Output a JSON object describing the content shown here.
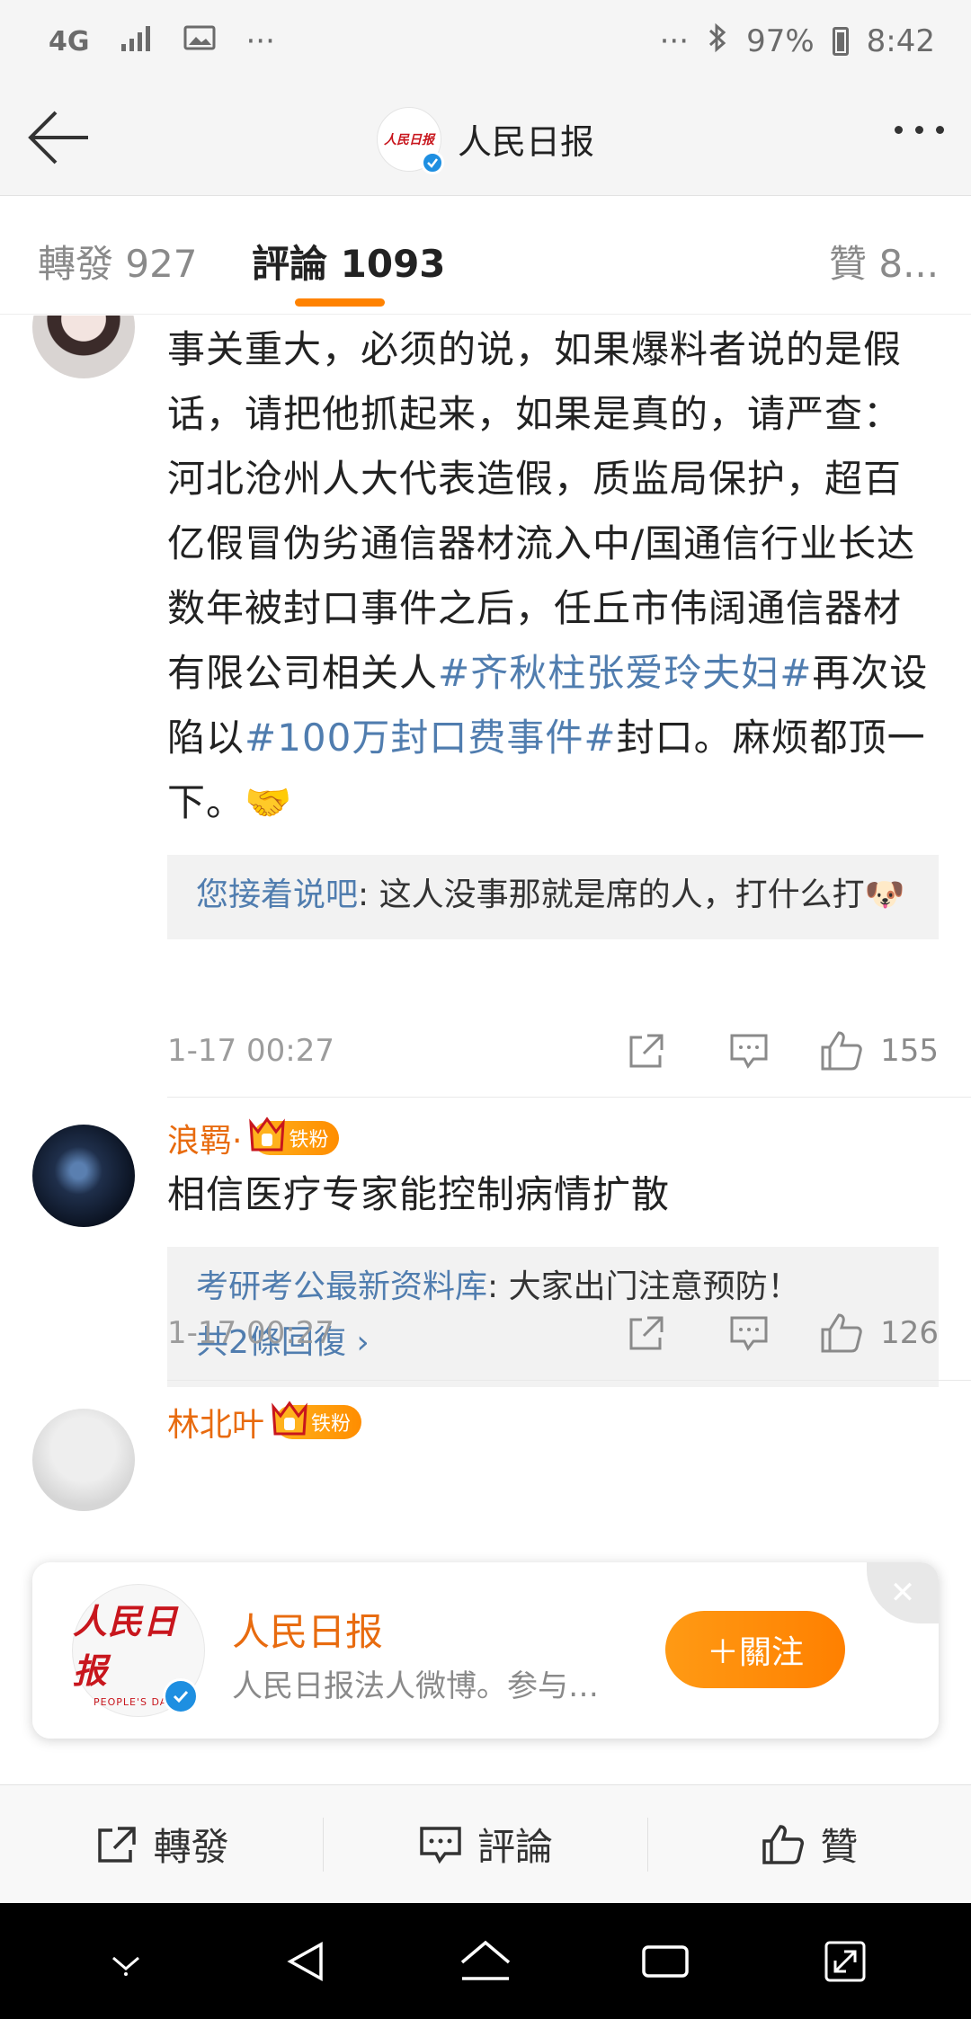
{
  "status_bar": {
    "network": "4G",
    "extra_dots_left": "···",
    "extra_dots_right": "···",
    "battery_percent": "97%",
    "time": "8:42"
  },
  "header": {
    "title": "人民日报",
    "avatar_logo_text": "人民日报"
  },
  "tabs": [
    {
      "label": "轉發 927"
    },
    {
      "label": "評論 1093"
    },
    {
      "label": "贊 8..."
    }
  ],
  "comments": [
    {
      "text_parts": {
        "p1": "事关重大，必须的说，如果爆料者说的是假话，请把他抓起来，如果是真的，请严查：河北沧州人大代表造假，质监局保护，超百亿假冒伪劣通信器材流入中/国通信行业长达数年被封口事件之后，任丘市伟阔通信器材有限公司相关人",
        "topic1": "#齐秋柱张爱玲夫妇#",
        "p2": "再次设陷以",
        "topic2": "#100万封口费事件#",
        "p3": "封口。麻烦都顶一 下。🤝"
      },
      "reply": {
        "name": "您接着说吧",
        "text": ": 这人没事那就是席的人，打什么打🐶"
      },
      "time": "1-17 00:27",
      "likes": "155"
    },
    {
      "name": "浪羁·",
      "badge": "铁粉",
      "text": "相信医疗专家能控制病情扩散",
      "reply": {
        "name": "考研考公最新资料库",
        "text": ": 大家出门注意预防！",
        "more": "共2條回復 ›"
      },
      "time": "1-17 00:27",
      "likes": "126"
    },
    {
      "name": "林北叶",
      "badge": "铁粉"
    }
  ],
  "follow_popup": {
    "logo_text": "人民日报",
    "logo_subtext": "PEOPLE'S DAILY",
    "name": "人民日报",
    "desc": "人民日报法人微博。参与…",
    "follow_label": "＋關注"
  },
  "bottom_bar": {
    "repost": "轉發",
    "comment": "評論",
    "like": "贊"
  },
  "colors": {
    "accent": "#ff8200",
    "name_orange": "#e86b0f",
    "link_blue": "#507daf",
    "verified_blue": "#1e8fe1"
  }
}
